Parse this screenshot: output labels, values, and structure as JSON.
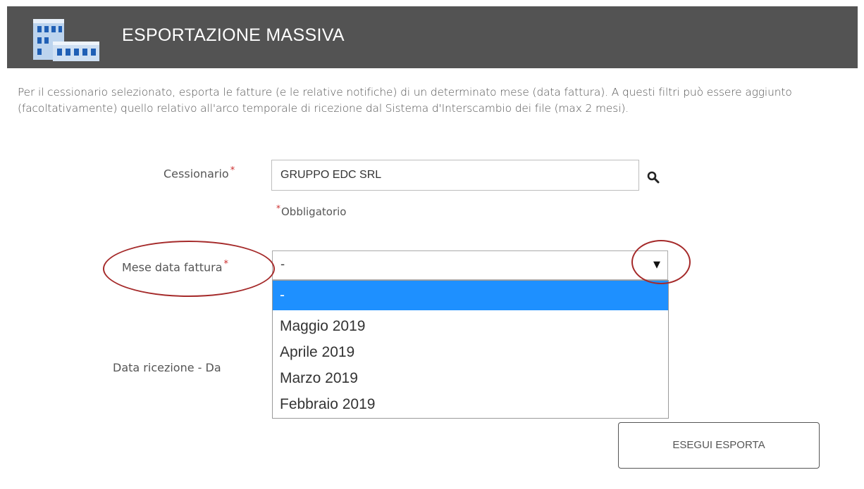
{
  "header": {
    "title": "ESPORTAZIONE MASSIVA",
    "logo_icon": "building-icon"
  },
  "intro": {
    "text": "Per il cessionario selezionato, esporta le fatture (e le relative notifiche) di un determinato mese (data fattura). A questi filtri può essere aggiunto (facoltativamente) quello relativo all'arco temporale di ricezione dal Sistema d'Interscambio dei file (max 2 mesi)."
  },
  "form": {
    "cessionario": {
      "label": "Cessionario",
      "required_mark": "*",
      "value": "GRUPPO EDC SRL",
      "search_icon": "search-icon"
    },
    "required_note": {
      "mark": "*",
      "text": "Obbligatorio"
    },
    "mese_data_fattura": {
      "label": "Mese data fattura",
      "required_mark": "*",
      "selected": "-",
      "arrow": "▼",
      "options": [
        "-",
        "Maggio 2019",
        "Aprile 2019",
        "Marzo 2019",
        "Febbraio 2019"
      ]
    },
    "data_ricezione": {
      "label": "Data ricezione - Da"
    },
    "export_button": "ESEGUI ESPORTA"
  },
  "colors": {
    "header_bg": "#535353",
    "selected_option_bg": "#1e90ff",
    "required_mark": "#cc2d2d",
    "annotation_circle": "#a52a2a"
  }
}
